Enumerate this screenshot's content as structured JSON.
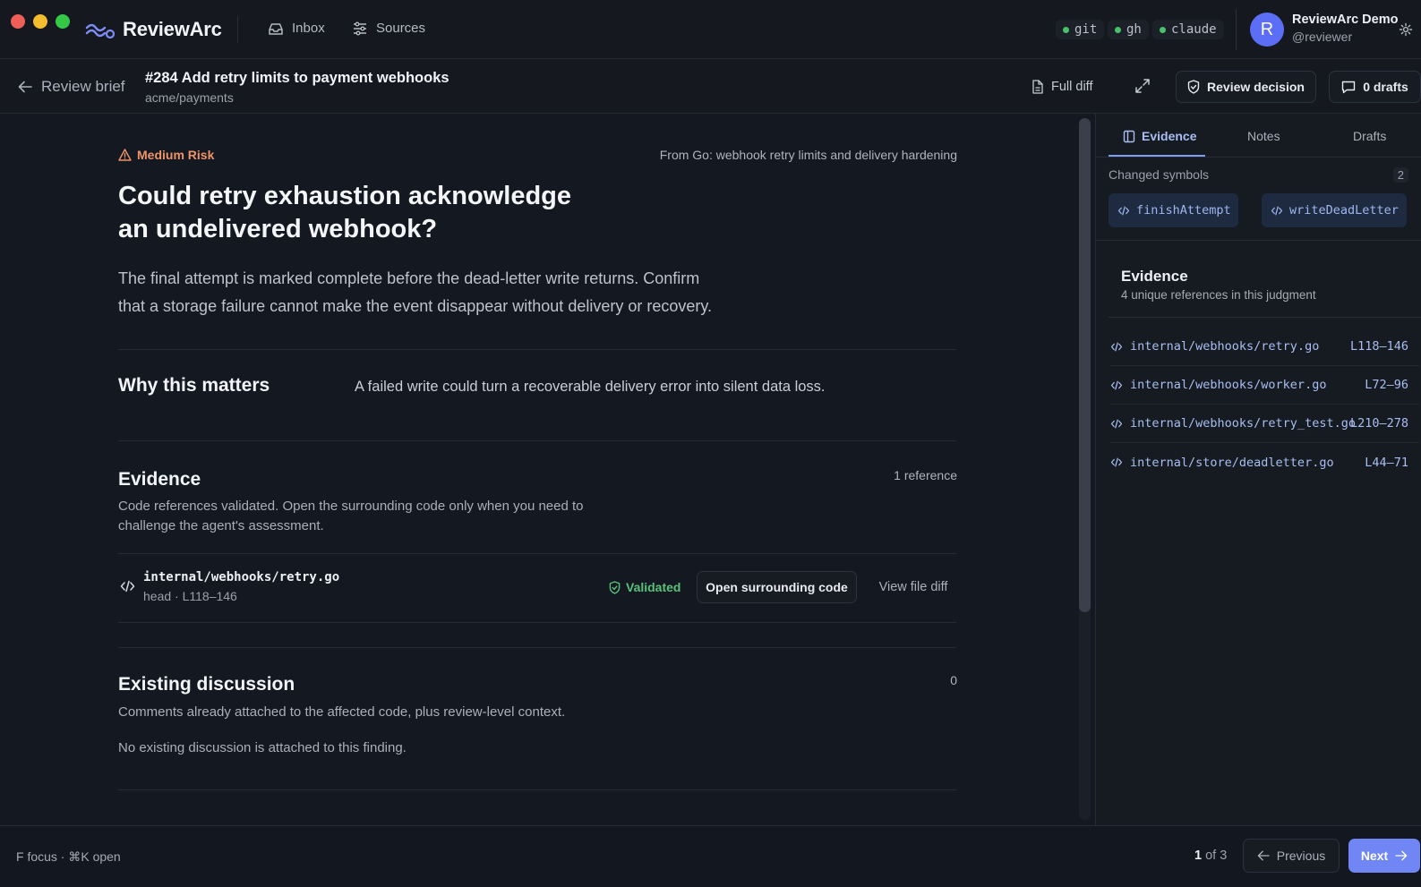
{
  "app": {
    "name": "ReviewArc"
  },
  "nav": {
    "inbox": "Inbox",
    "sources": "Sources"
  },
  "tools": [
    "git",
    "gh",
    "claude"
  ],
  "user": {
    "initial": "R",
    "name": "ReviewArc Demo",
    "handle": "@reviewer"
  },
  "header": {
    "back_label": "Review brief",
    "pr_title": "#284 Add retry limits to payment webhooks",
    "repo": "acme/payments",
    "full_diff": "Full diff",
    "review_decision": "Review decision",
    "drafts": "0 drafts"
  },
  "finding": {
    "risk": "Medium Risk",
    "source": "From Go: webhook retry limits and delivery hardening",
    "title_line1": "Could retry exhaustion acknowledge",
    "title_line2": "an undelivered webhook?",
    "desc_line1": "The final attempt is marked complete before the dead-letter write returns. Confirm",
    "desc_line2": "that a storage failure cannot make the event disappear without delivery or recovery.",
    "why_heading": "Why this matters",
    "why_text": "A failed write could turn a recoverable delivery error into silent data loss."
  },
  "evidence": {
    "heading": "Evidence",
    "count": "1 reference",
    "desc_line1": "Code references validated. Open the surrounding code only when you need to",
    "desc_line2": "challenge the agent's assessment.",
    "item": {
      "path": "internal/webhooks/retry.go",
      "meta": "head · L118–146",
      "status": "Validated",
      "open_button": "Open surrounding code",
      "view_diff": "View file diff"
    }
  },
  "discussion": {
    "heading": "Existing discussion",
    "count": "0",
    "desc": "Comments already attached to the affected code, plus review-level context.",
    "empty": "No existing discussion is attached to this finding."
  },
  "panel": {
    "tabs": [
      "Evidence",
      "Notes",
      "Drafts"
    ],
    "changed_label": "Changed symbols",
    "changed_count": "2",
    "symbols": [
      "finishAttempt",
      "writeDeadLetter"
    ],
    "evidence_title": "Evidence",
    "evidence_sub": "4 unique references in this judgment",
    "refs": [
      {
        "path": "internal/webhooks/retry.go",
        "lines": "L118–146"
      },
      {
        "path": "internal/webhooks/worker.go",
        "lines": "L72–96"
      },
      {
        "path": "internal/webhooks/retry_test.go",
        "lines": "L210–278"
      },
      {
        "path": "internal/store/deadletter.go",
        "lines": "L44–71"
      }
    ]
  },
  "footer": {
    "hint": "F focus · ⌘K open",
    "page_current": "1",
    "page_of": "of 3",
    "previous": "Previous",
    "next": "Next"
  },
  "colors": {
    "accent": "#5c6ef5",
    "risk": "#ef9467",
    "validated": "#58c27b",
    "link": "#a8bef2"
  }
}
